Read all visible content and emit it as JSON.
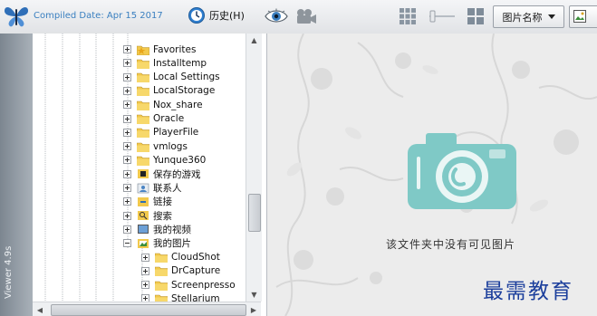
{
  "toolbar": {
    "compiled_date": "Compiled Date: Apr 15 2017",
    "history_label": "历史(H)",
    "sort_label": "图片名称"
  },
  "sidebar": {
    "vertical_label": "Viewer 4.9s"
  },
  "tree": {
    "items": [
      {
        "label": "Favorites",
        "icon": "star-folder-icon"
      },
      {
        "label": "Installtemp",
        "icon": "folder-icon"
      },
      {
        "label": "Local Settings",
        "icon": "folder-icon"
      },
      {
        "label": "LocalStorage",
        "icon": "folder-icon"
      },
      {
        "label": "Nox_share",
        "icon": "folder-icon"
      },
      {
        "label": "Oracle",
        "icon": "folder-icon"
      },
      {
        "label": "PlayerFile",
        "icon": "folder-icon"
      },
      {
        "label": "vmlogs",
        "icon": "folder-icon"
      },
      {
        "label": "Yunque360",
        "icon": "folder-icon"
      },
      {
        "label": "保存的游戏",
        "icon": "saved-games-icon"
      },
      {
        "label": "联系人",
        "icon": "contacts-icon"
      },
      {
        "label": "链接",
        "icon": "links-icon"
      },
      {
        "label": "搜索",
        "icon": "search-folder-icon"
      },
      {
        "label": "我的视频",
        "icon": "videos-icon"
      },
      {
        "label": "我的图片",
        "icon": "pictures-icon",
        "expanded": true
      },
      {
        "label": "CloudShot",
        "icon": "folder-icon"
      },
      {
        "label": "DrCapture",
        "icon": "folder-icon"
      },
      {
        "label": "Screenpresso",
        "icon": "folder-icon"
      },
      {
        "label": "Stellarium",
        "icon": "folder-icon"
      }
    ]
  },
  "viewer": {
    "empty_message": "该文件夹中没有可见图片"
  },
  "watermark": "最需教育",
  "colors": {
    "accent_blue": "#3a7fc0",
    "camera_teal": "#7fc9c6",
    "folder_yellow": "#f2c94c",
    "watermark_blue": "#1c3f9c"
  }
}
